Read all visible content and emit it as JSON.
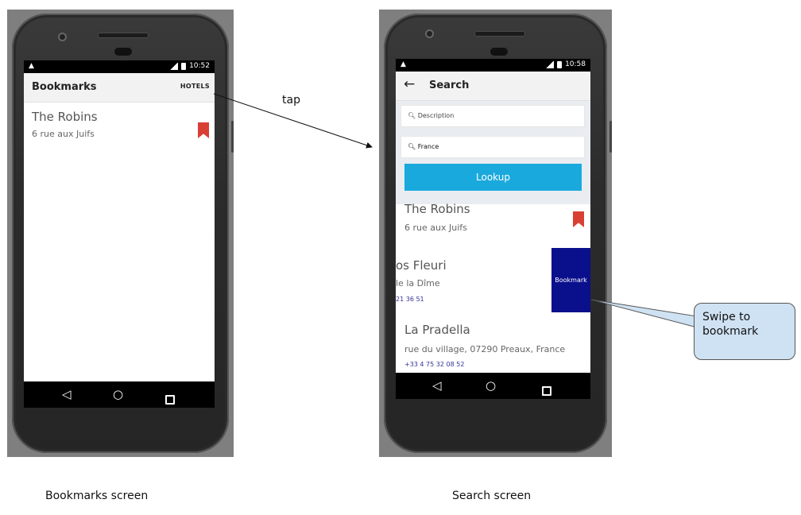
{
  "bookmarks_screen": {
    "status_time": "10:52",
    "title": "Bookmarks",
    "action": "HOTELS",
    "hotels": [
      {
        "name": "The Robins",
        "address": "6 rue aux Juifs"
      }
    ],
    "caption": "Bookmarks screen"
  },
  "search_screen": {
    "status_time": "10:58",
    "title": "Search",
    "description_placeholder": "Description",
    "location_value": "France",
    "lookup_label": "Lookup",
    "hotels": [
      {
        "name": "The Robins",
        "address": "6 rue aux Juifs"
      },
      {
        "name": "os Fleuri",
        "address": "le la Dîme",
        "phone": "21 36 51"
      },
      {
        "name": "La Pradella",
        "address": "rue du village, 07290 Preaux, France",
        "phone": "+33 4 75 32 08 52"
      }
    ],
    "swipe_action": "Bookmark",
    "caption": "Search screen"
  },
  "annotations": {
    "tap": "tap",
    "swipe_callout": "Swipe to bookmark"
  },
  "colors": {
    "bookmark_red": "#d94033",
    "lookup_blue": "#1aa9dd",
    "swipe_navy": "#0a0f8c",
    "callout_fill": "#cfe2f3"
  }
}
